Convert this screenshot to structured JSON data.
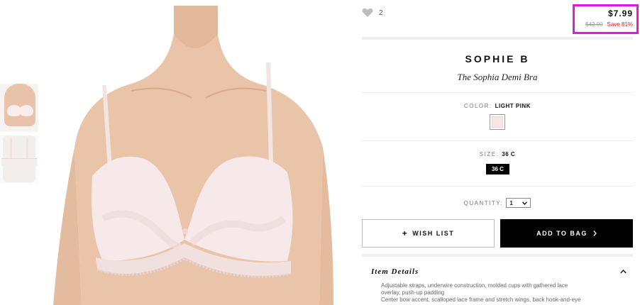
{
  "likes": {
    "count": "2",
    "icon": "heart-icon"
  },
  "price": {
    "current": "$7.99",
    "original": "$42.00",
    "save": "Save 81%",
    "highlight_color": "#e018e0",
    "save_color": "#d42020"
  },
  "product": {
    "brand": "SOPHIE B",
    "name": "The Sophia Demi Bra"
  },
  "color": {
    "label": "COLOR:",
    "value": "LIGHT PINK",
    "swatch": "#f7e6e6"
  },
  "size": {
    "label": "SIZE:",
    "value": "36 C",
    "chip": "36 C"
  },
  "quantity": {
    "label": "QUANTITY:",
    "value": "1"
  },
  "buttons": {
    "wishlist": "WISH LIST",
    "add_to_bag": "ADD TO BAG"
  },
  "details": {
    "title": "Item Details",
    "lines": [
      "Adjustable straps, underwire construction, molded cups with gathered lace",
      "overlay, push-up padding",
      "Center bow accent, scalloped lace frame and stretch wings, back hook-and-eye"
    ]
  }
}
